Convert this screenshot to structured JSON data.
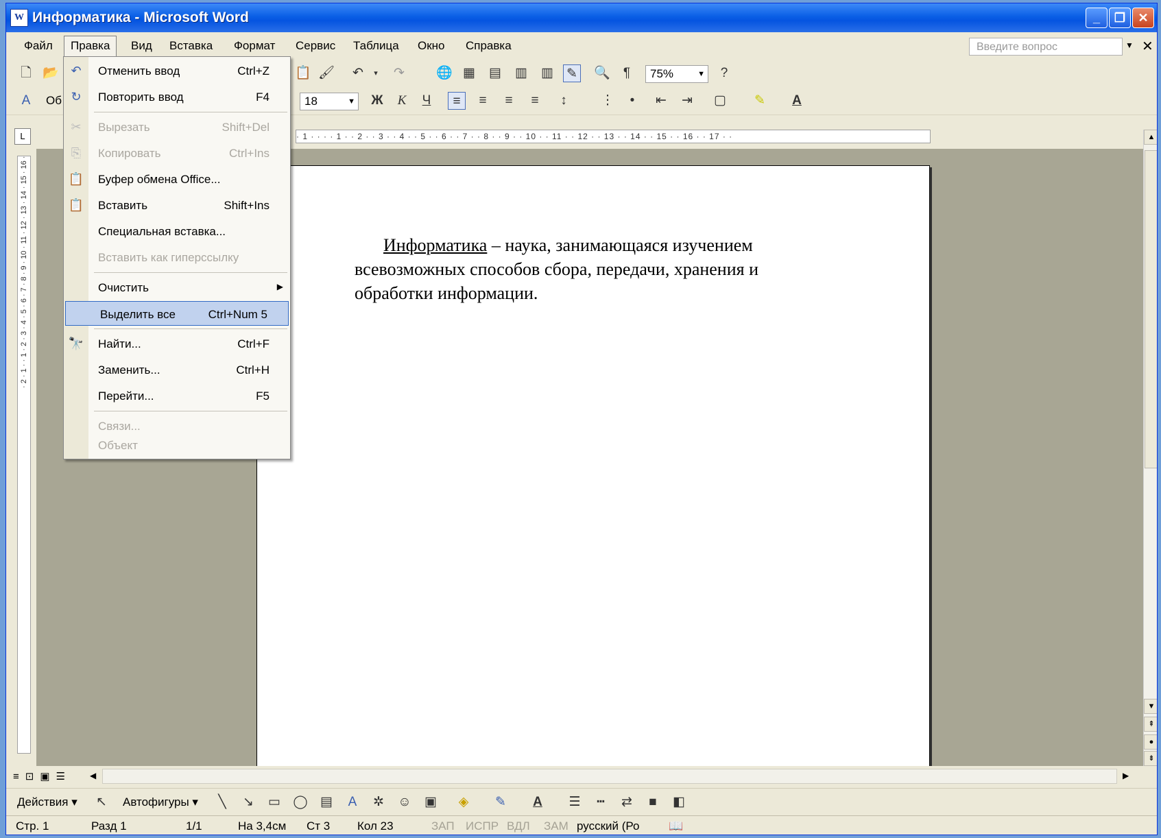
{
  "window": {
    "title": "Информатика - Microsoft Word",
    "app_icon": "W"
  },
  "menubar": {
    "items": [
      "Файл",
      "Правка",
      "Вид",
      "Вставка",
      "Формат",
      "Сервис",
      "Таблица",
      "Окно",
      "Справка"
    ],
    "active": "Правка",
    "ask_placeholder": "Введите вопрос"
  },
  "toolbar": {
    "zoom": "75%",
    "font_size": "18",
    "style_partial": "Об"
  },
  "edit_menu": {
    "items": [
      {
        "label": "Отменить ввод",
        "shortcut": "Ctrl+Z",
        "icon": "undo-icon"
      },
      {
        "label": "Повторить ввод",
        "shortcut": "F4",
        "icon": "redo-icon"
      },
      {
        "label": "Вырезать",
        "shortcut": "Shift+Del",
        "icon": "scissors-icon"
      },
      {
        "label": "Копировать",
        "shortcut": "Ctrl+Ins",
        "icon": "copy-icon"
      },
      {
        "label": "Буфер обмена Office...",
        "shortcut": "",
        "icon": "clipboard-icon"
      },
      {
        "label": "Вставить",
        "shortcut": "Shift+Ins",
        "icon": "paste-icon"
      },
      {
        "label": "Специальная вставка...",
        "shortcut": ""
      },
      {
        "label": "Вставить как гиперссылку",
        "shortcut": ""
      },
      {
        "label": "Очистить",
        "shortcut": ""
      },
      {
        "label": "Выделить все",
        "shortcut": "Ctrl+Num 5"
      },
      {
        "label": "Найти...",
        "shortcut": "Ctrl+F",
        "icon": "binoculars-icon"
      },
      {
        "label": "Заменить...",
        "shortcut": "Ctrl+H"
      },
      {
        "label": "Перейти...",
        "shortcut": "F5"
      },
      {
        "label": "Связи...",
        "shortcut": ""
      },
      {
        "label": "Объект",
        "shortcut": ""
      }
    ],
    "highlighted": "Выделить все"
  },
  "document": {
    "term": "Информатика",
    "line1_rest": " – наука, занимающаяся изучением",
    "line2": "всевозможных способов сбора, передачи, хранения и",
    "line3": "обработки информации."
  },
  "ruler": {
    "h_ticks": "· 1 · ·  · · 1 · · 2 · · 3 · · 4 · · 5 · · 6 · · 7 · · 8 · · 9 · · 10 · · 11 · · 12 · · 13 · · 14 · · 15 · · 16 · · 17 · ·",
    "v_ticks": "· 2 · 1 · · 1 · 2 · 3 · 4 · 5 · 6 · 7 · 8 · 9 · 10 · 11 · 12 · 13 · 14 · 15 · 16 ·"
  },
  "drawbar": {
    "actions": "Действия ▾",
    "autoshapes": "Автофигуры ▾"
  },
  "statusbar": {
    "page": "Стр. 1",
    "section": "Разд 1",
    "pages": "1/1",
    "at": "На 3,4см",
    "line": "Ст 3",
    "col": "Кол 23",
    "rec": "ЗАП",
    "trk": "ИСПР",
    "ext": "ВДЛ",
    "ovr": "ЗАМ",
    "lang": "русский (Ро"
  }
}
